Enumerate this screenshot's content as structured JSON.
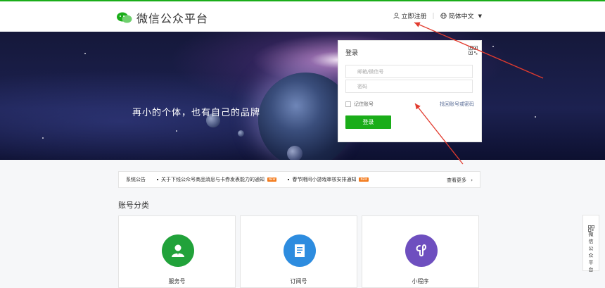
{
  "header": {
    "logo_text": "微信公众平台",
    "register_label": "立即注册",
    "language_label": "简体中文"
  },
  "banner": {
    "slogan": "再小的个体，也有自己的品牌"
  },
  "login": {
    "title": "登录",
    "email_placeholder": "邮箱/微信号",
    "password_placeholder": "密码",
    "remember_label": "记住账号",
    "forgot_label": "找回账号或密码",
    "submit_label": "登录"
  },
  "notice": {
    "title": "系统公告",
    "items": [
      {
        "text": "关于下线公众号商品消息与卡券发表能力的通知",
        "badge": "NEW"
      },
      {
        "text": "春节期间小游戏审核安排通知",
        "badge": "NEW"
      }
    ],
    "more_label": "查看更多"
  },
  "section_title": "账号分类",
  "cards": [
    {
      "label": "服务号",
      "color": "#21a23a",
      "icon": "person-icon"
    },
    {
      "label": "订阅号",
      "color": "#2d8cdf",
      "icon": "document-icon"
    },
    {
      "label": "小程序",
      "color": "#6e4fbf",
      "icon": "mini-program-icon"
    }
  ],
  "sidebar_widget": {
    "text": "微信公众平台"
  },
  "colors": {
    "brand_green": "#1aad19",
    "arrow_red": "#e23b2e",
    "link_blue": "#576b95"
  }
}
